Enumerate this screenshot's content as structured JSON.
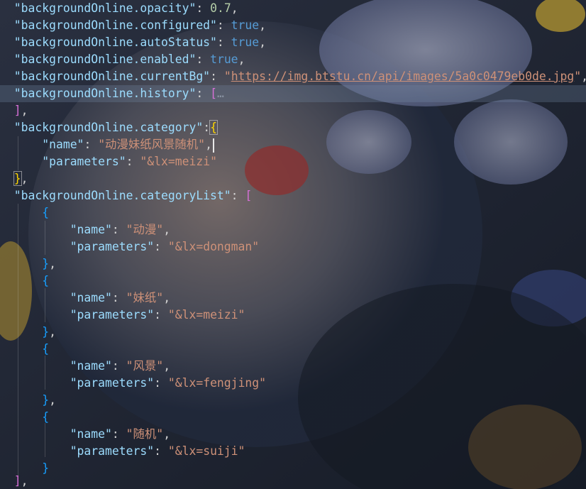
{
  "editor": {
    "lines": [
      {
        "id": "opacity",
        "key": "\"backgroundOnline.opacity\"",
        "sep": ": ",
        "value": "0.7",
        "tail": ","
      },
      {
        "id": "configured",
        "key": "\"backgroundOnline.configured\"",
        "sep": ": ",
        "value": "true",
        "tail": ","
      },
      {
        "id": "autostatus",
        "key": "\"backgroundOnline.autoStatus\"",
        "sep": ": ",
        "value": "true",
        "tail": ","
      },
      {
        "id": "enabled",
        "key": "\"backgroundOnline.enabled\"",
        "sep": ": ",
        "value": "true",
        "tail": ","
      },
      {
        "id": "currentbg",
        "key": "\"backgroundOnline.currentBg\"",
        "sep": ": ",
        "quote": "\"",
        "value": "https://img.btstu.cn/api/images/5a0c0479eb0de.jpg",
        "tail": ","
      },
      {
        "id": "history",
        "key": "\"backgroundOnline.history\"",
        "sep": ": ",
        "open": "[",
        "folded": "…"
      },
      {
        "id": "history-close",
        "close": "]",
        "tail": ","
      },
      {
        "id": "category",
        "key": "\"backgroundOnline.category\"",
        "sep": ":",
        "open": "{"
      },
      {
        "id": "category-name",
        "key": "\"name\"",
        "sep": ": ",
        "value": "\"动漫妹纸风景随机\"",
        "tail": ","
      },
      {
        "id": "category-params",
        "key": "\"parameters\"",
        "sep": ": ",
        "value": "\"&lx=meizi\""
      },
      {
        "id": "category-close",
        "close": "}",
        "tail": ","
      },
      {
        "id": "categorylist",
        "key": "\"backgroundOnline.categoryList\"",
        "sep": ": ",
        "open": "["
      },
      {
        "id": "item1-open",
        "open": "{"
      },
      {
        "id": "item1-name",
        "key": "\"name\"",
        "sep": ": ",
        "value": "\"动漫\"",
        "tail": ","
      },
      {
        "id": "item1-params",
        "key": "\"parameters\"",
        "sep": ": ",
        "value": "\"&lx=dongman\""
      },
      {
        "id": "item1-close",
        "close": "}",
        "tail": ","
      },
      {
        "id": "item2-open",
        "open": "{"
      },
      {
        "id": "item2-name",
        "key": "\"name\"",
        "sep": ": ",
        "value": "\"妹纸\"",
        "tail": ","
      },
      {
        "id": "item2-params",
        "key": "\"parameters\"",
        "sep": ": ",
        "value": "\"&lx=meizi\""
      },
      {
        "id": "item2-close",
        "close": "}",
        "tail": ","
      },
      {
        "id": "item3-open",
        "open": "{"
      },
      {
        "id": "item3-name",
        "key": "\"name\"",
        "sep": ": ",
        "value": "\"风景\"",
        "tail": ","
      },
      {
        "id": "item3-params",
        "key": "\"parameters\"",
        "sep": ": ",
        "value": "\"&lx=fengjing\""
      },
      {
        "id": "item3-close",
        "close": "}",
        "tail": ","
      },
      {
        "id": "item4-open",
        "open": "{"
      },
      {
        "id": "item4-name",
        "key": "\"name\"",
        "sep": ": ",
        "value": "\"随机\"",
        "tail": ","
      },
      {
        "id": "item4-params",
        "key": "\"parameters\"",
        "sep": ": ",
        "value": "\"&lx=suiji\""
      },
      {
        "id": "item4-close",
        "close": "}"
      },
      {
        "id": "categorylist-close",
        "close": "]",
        "tail": ","
      }
    ]
  },
  "colors": {
    "key": "#9cdcfe",
    "string": "#ce9178",
    "number": "#b5cea8",
    "boolean": "#569cd6",
    "bracket_magenta": "#d670d6",
    "bracket_gold": "#ffd700",
    "bracket_blue": "#179fff"
  }
}
